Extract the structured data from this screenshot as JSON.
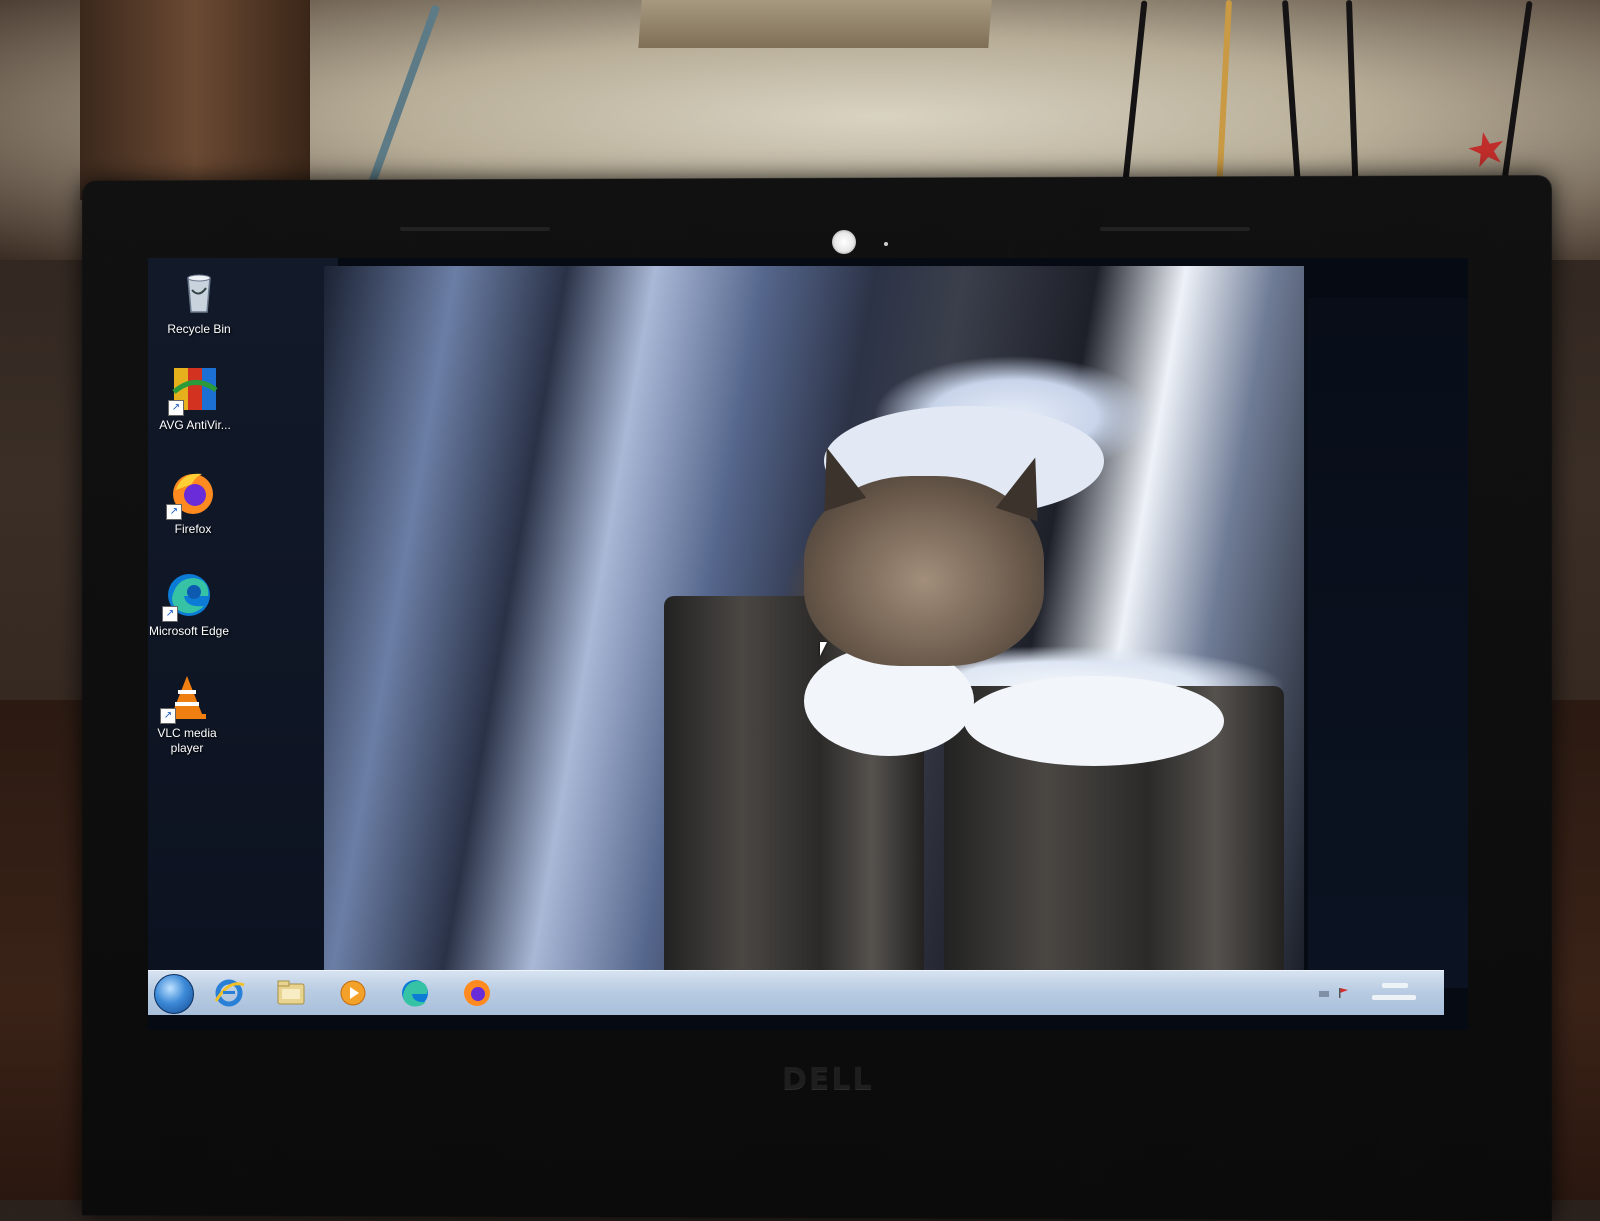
{
  "desktop": {
    "icons": [
      {
        "label": "Recycle Bin",
        "icon": "recycle-bin-icon",
        "shortcut": false
      },
      {
        "label": "AVG AntiVir...",
        "icon": "avg-antivirus-icon",
        "shortcut": true
      },
      {
        "label": "Firefox",
        "icon": "firefox-icon",
        "shortcut": true
      },
      {
        "label": "Microsoft Edge",
        "icon": "edge-icon",
        "shortcut": true
      },
      {
        "label": "VLC media player",
        "icon": "vlc-icon",
        "shortcut": true
      }
    ],
    "wallpaper": "lynx-on-snowy-stump"
  },
  "taskbar": {
    "start_icon": "windows-start-orb-icon",
    "pinned": [
      {
        "icon": "internet-explorer-icon"
      },
      {
        "icon": "file-explorer-icon"
      },
      {
        "icon": "media-player-icon"
      },
      {
        "icon": "edge-icon"
      },
      {
        "icon": "firefox-icon"
      }
    ],
    "tray": {
      "icons": [
        "network-icon",
        "flag-icon"
      ]
    }
  },
  "hardware": {
    "brand": "DELL"
  },
  "colors": {
    "taskbar": "#b9cce2",
    "screen_bg": "#060a12",
    "bezel": "#0b0b0b"
  }
}
